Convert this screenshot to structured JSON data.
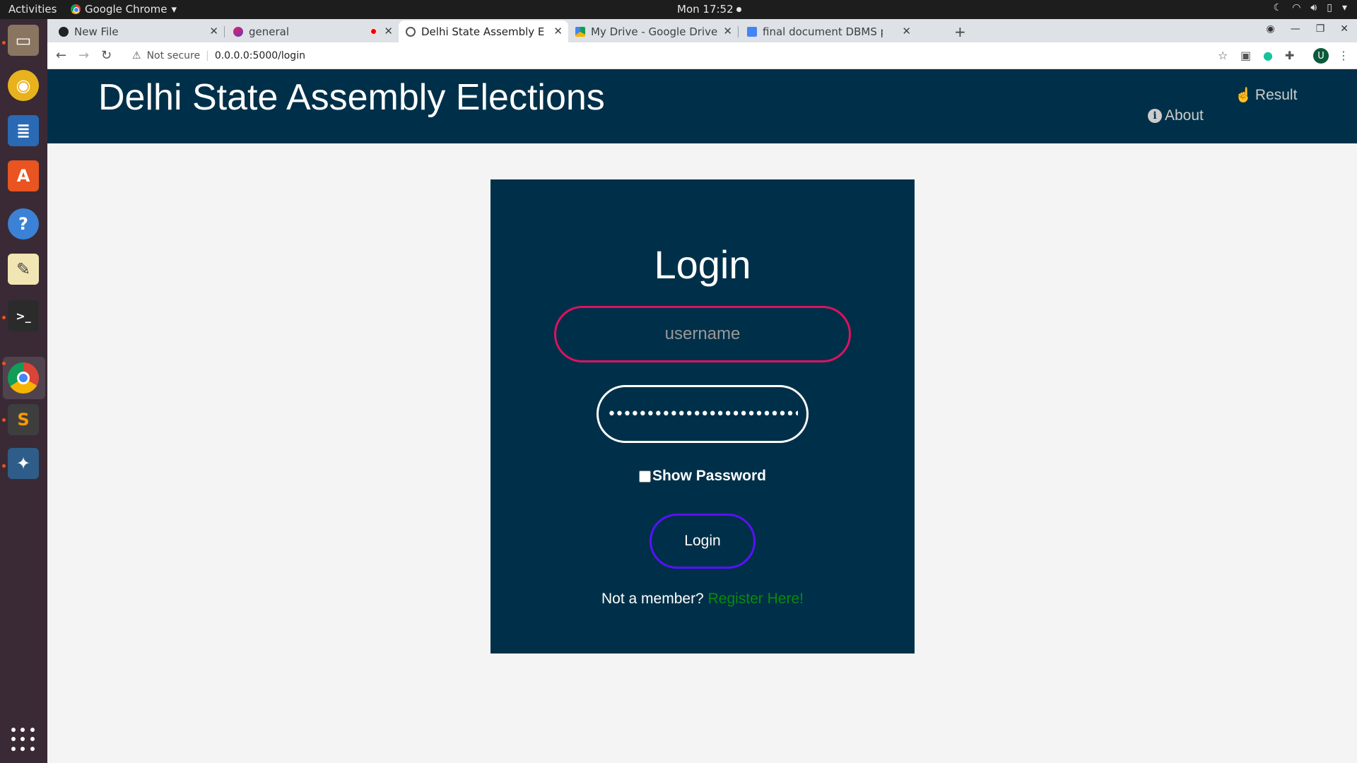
{
  "os": {
    "activities": "Activities",
    "app_name": "Google Chrome",
    "clock": "Mon 17:52"
  },
  "browser": {
    "tabs": [
      {
        "title": "New File"
      },
      {
        "title": "general"
      },
      {
        "title": "Delhi State Assembly Elec"
      },
      {
        "title": "My Drive - Google Drive"
      },
      {
        "title": "final document DBMS pro"
      }
    ],
    "security_label": "Not secure",
    "url": "0.0.0.0:5000/login",
    "profile_initial": "U"
  },
  "site": {
    "title": "Delhi State Assembly Elections",
    "nav": {
      "result": "Result",
      "about": "About"
    }
  },
  "login": {
    "title": "Login",
    "username_placeholder": "username",
    "password_value": "••••••••••••••••••••••••••••••",
    "show_password_label": "Show Password",
    "button_label": "Login",
    "not_member": "Not a member?",
    "register_link": "Register Here!"
  },
  "colors": {
    "header_bg": "#003049",
    "username_border": "#e0115f",
    "login_button_border": "#5a10ff",
    "register_link": "#0a8a0a"
  }
}
